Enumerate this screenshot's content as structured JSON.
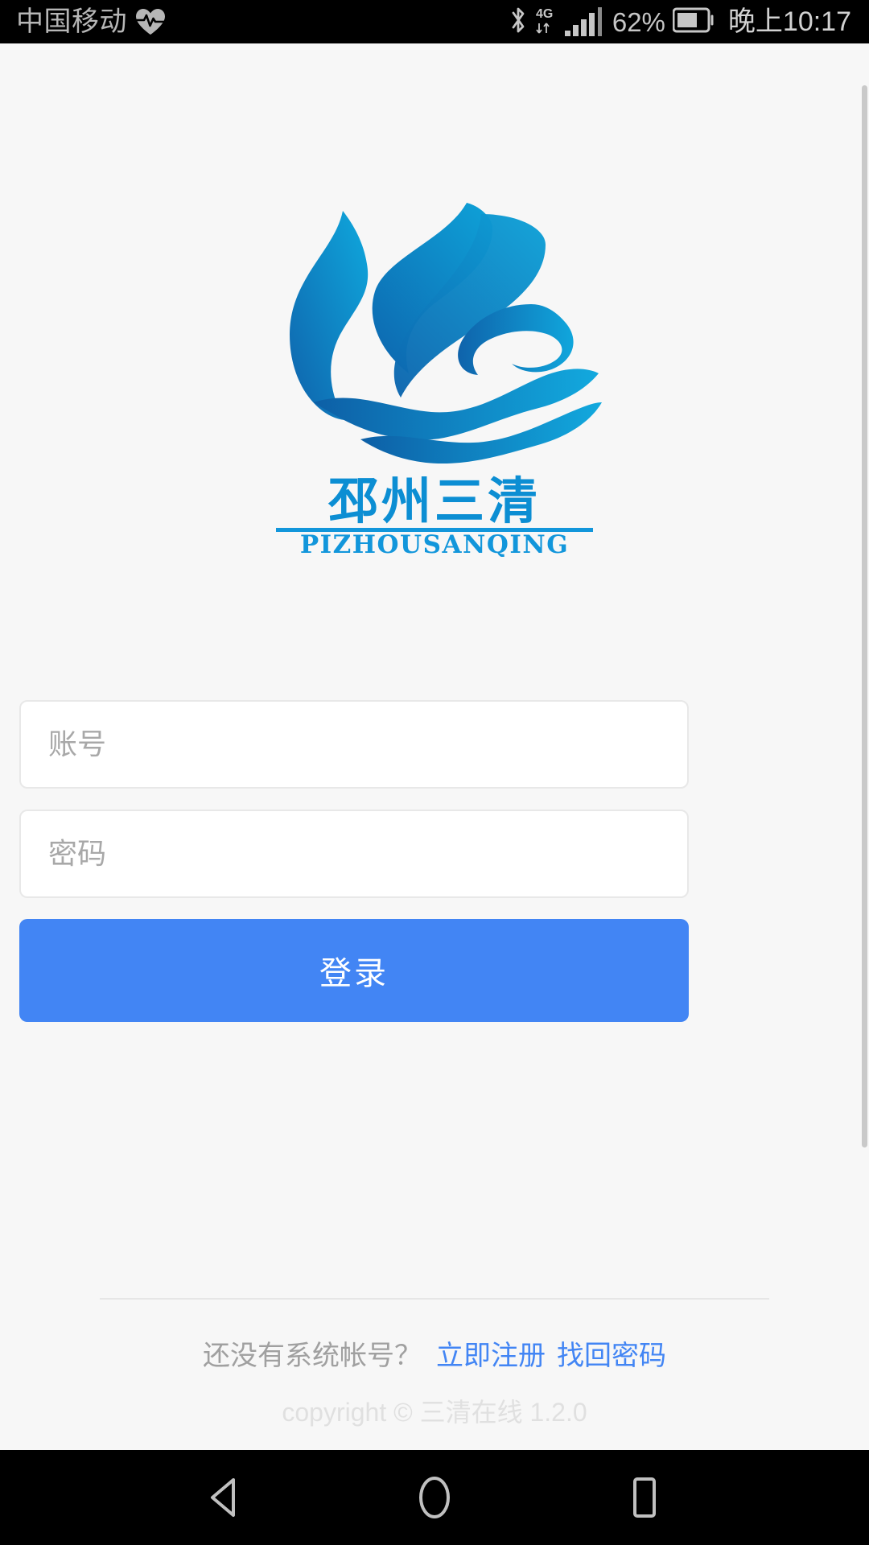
{
  "status_bar": {
    "carrier": "中国移动",
    "carrier_icon": "heart-pulse-icon",
    "bluetooth_icon": "bluetooth-icon",
    "network_type": "4G",
    "data_arrows_icon": "data-transfer-arrows-icon",
    "signal_icon": "signal-bars-icon",
    "battery_percent": "62%",
    "battery_icon": "battery-icon",
    "clock": "晚上10:17"
  },
  "brand": {
    "logo_icon": "lotus-wave-logo-icon",
    "name_cn": "邳州三清",
    "name_en": "PIZHOUSANQING",
    "primary_color": "#0d8fd0",
    "deep_color": "#0c5fa6"
  },
  "form": {
    "account": {
      "placeholder": "账号",
      "value": ""
    },
    "password": {
      "placeholder": "密码",
      "value": ""
    },
    "login_label": "登录",
    "accent_color": "#4285f4"
  },
  "footer": {
    "prompt": "还没有系统帐号？",
    "register_label": "立即注册",
    "recover_label": "找回密码",
    "copyright": "copyright © 三清在线 1.2.0"
  },
  "nav_bar": {
    "back_icon": "back-triangle-icon",
    "home_icon": "home-circle-icon",
    "recents_icon": "recents-square-icon"
  }
}
